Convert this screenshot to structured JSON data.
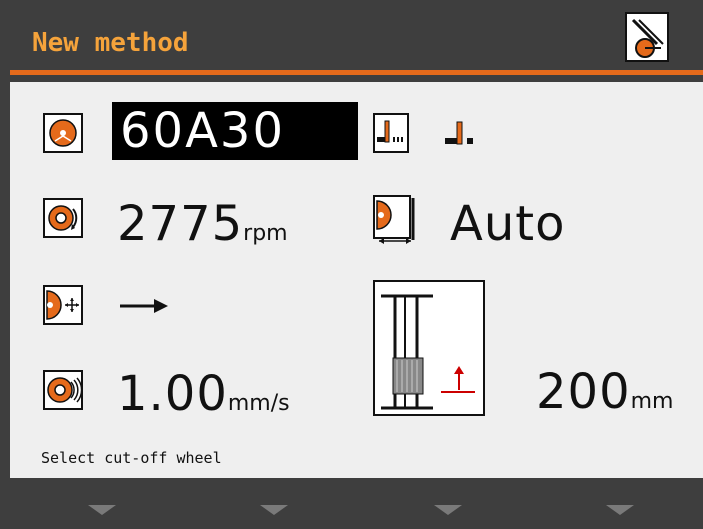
{
  "header": {
    "title": "New method",
    "accent_color": "#e56a1b",
    "title_color": "#f5a33b",
    "corner_icon": "method-settings-icon"
  },
  "settings": {
    "wheel": {
      "icon": "cutoff-wheel-icon",
      "value": "60A30"
    },
    "cut_mode": {
      "icon": "cut-mode-icon",
      "value_icon": "single-cut-icon"
    },
    "speed": {
      "icon": "wheel-speed-icon",
      "value": "2775",
      "unit": "rpm"
    },
    "cut_distance": {
      "icon": "cut-distance-icon",
      "value": "Auto"
    },
    "direction": {
      "icon": "feed-direction-icon",
      "value_icon": "arrow-right-icon"
    },
    "feed": {
      "icon": "feed-speed-icon",
      "value": "1.00",
      "unit": "mm/s"
    },
    "stroke": {
      "icon": "vise-stroke-icon",
      "value": "200",
      "unit": "mm"
    }
  },
  "status": {
    "text": "Select cut-off wheel"
  },
  "softkeys": [
    {
      "icon": "softkey-down-icon"
    },
    {
      "icon": "softkey-down-icon"
    },
    {
      "icon": "softkey-down-icon"
    },
    {
      "icon": "softkey-down-icon"
    }
  ]
}
